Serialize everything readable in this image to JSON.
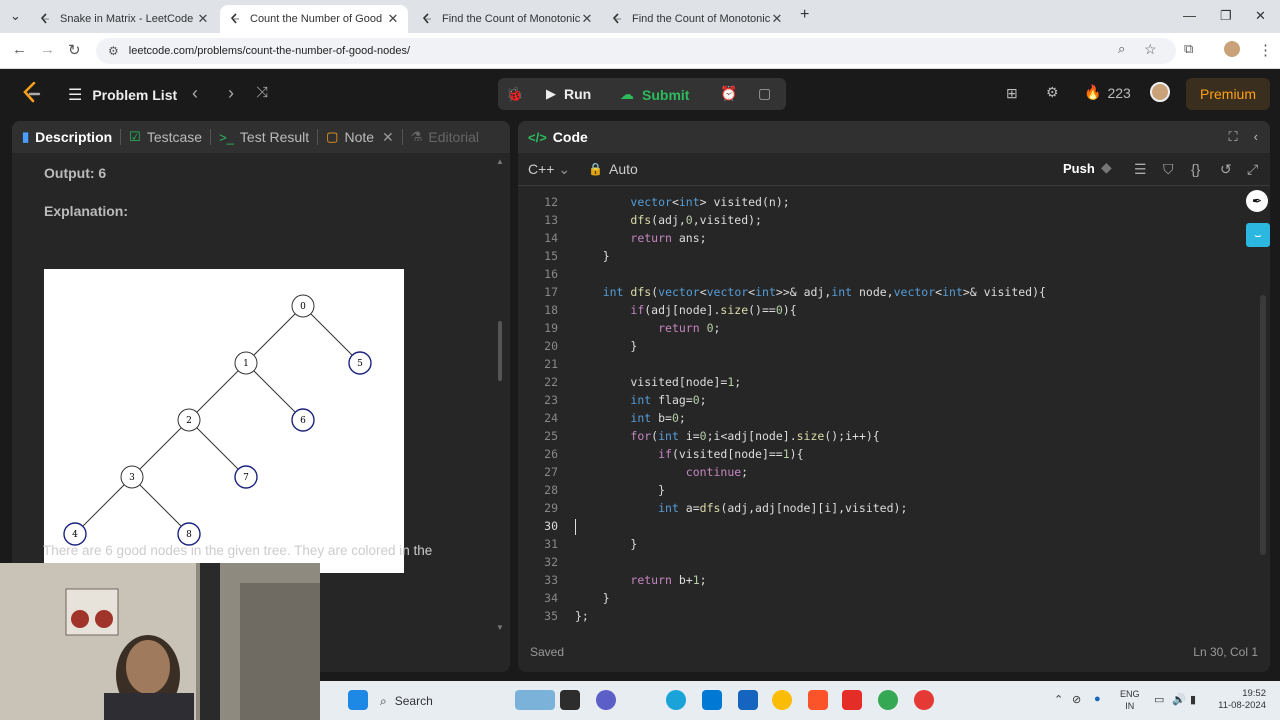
{
  "browser": {
    "tabs": [
      {
        "title": "Snake in Matrix - LeetCode",
        "active": false
      },
      {
        "title": "Count the Number of Good No",
        "active": true
      },
      {
        "title": "Find the Count of Monotonic P",
        "active": false
      },
      {
        "title": "Find the Count of Monotonic P",
        "active": false
      }
    ],
    "url": "leetcode.com/problems/count-the-number-of-good-nodes/"
  },
  "lc_header": {
    "problem_list": "Problem List",
    "run": "Run",
    "submit": "Submit",
    "streak": "223",
    "premium": "Premium"
  },
  "left_tabs": [
    {
      "label": "Description",
      "icon": "document-icon"
    },
    {
      "label": "Testcase",
      "icon": "checkbox-icon"
    },
    {
      "label": "Test Result",
      "icon": "terminal-icon"
    },
    {
      "label": "Note",
      "icon": "note-icon"
    },
    {
      "label": "Editorial",
      "icon": "flask-icon"
    }
  ],
  "description": {
    "output": "Output: 6",
    "explanation": "Explanation:",
    "text": "There are 6 good nodes in the given tree. They are colored in the"
  },
  "tree_nodes": [
    "0",
    "1",
    "5",
    "2",
    "6",
    "3",
    "7",
    "4",
    "8"
  ],
  "code_panel": {
    "title": "Code",
    "language": "C++",
    "mode": "Auto",
    "push": "Push",
    "status_left": "Saved",
    "status_right": "Ln 30, Col 1"
  },
  "code_lines": [
    {
      "n": "12",
      "text": "        vector<int> visited(n);"
    },
    {
      "n": "13",
      "text": "        dfs(adj,0,visited);"
    },
    {
      "n": "14",
      "text": "        return ans;"
    },
    {
      "n": "15",
      "text": "    }"
    },
    {
      "n": "16",
      "text": ""
    },
    {
      "n": "17",
      "text": "    int dfs(vector<vector<int>>& adj,int node,vector<int>& visited){"
    },
    {
      "n": "18",
      "text": "        if(adj[node].size()==0){"
    },
    {
      "n": "19",
      "text": "            return 0;"
    },
    {
      "n": "20",
      "text": "        }"
    },
    {
      "n": "21",
      "text": ""
    },
    {
      "n": "22",
      "text": "        visited[node]=1;"
    },
    {
      "n": "23",
      "text": "        int flag=0;"
    },
    {
      "n": "24",
      "text": "        int b=0;"
    },
    {
      "n": "25",
      "text": "        for(int i=0;i<adj[node].size();i++){"
    },
    {
      "n": "26",
      "text": "            if(visited[node]==1){"
    },
    {
      "n": "27",
      "text": "                continue;"
    },
    {
      "n": "28",
      "text": "            }"
    },
    {
      "n": "29",
      "text": "            int a=dfs(adj,adj[node][i],visited);"
    },
    {
      "n": "30",
      "text": ""
    },
    {
      "n": "31",
      "text": "        }"
    },
    {
      "n": "32",
      "text": ""
    },
    {
      "n": "33",
      "text": "        return b+1;"
    },
    {
      "n": "34",
      "text": "    }"
    },
    {
      "n": "35",
      "text": "};"
    }
  ],
  "taskbar": {
    "search": "Search",
    "lang": "ENG",
    "region": "IN",
    "time": "19:52",
    "date": "11-08-2024"
  }
}
